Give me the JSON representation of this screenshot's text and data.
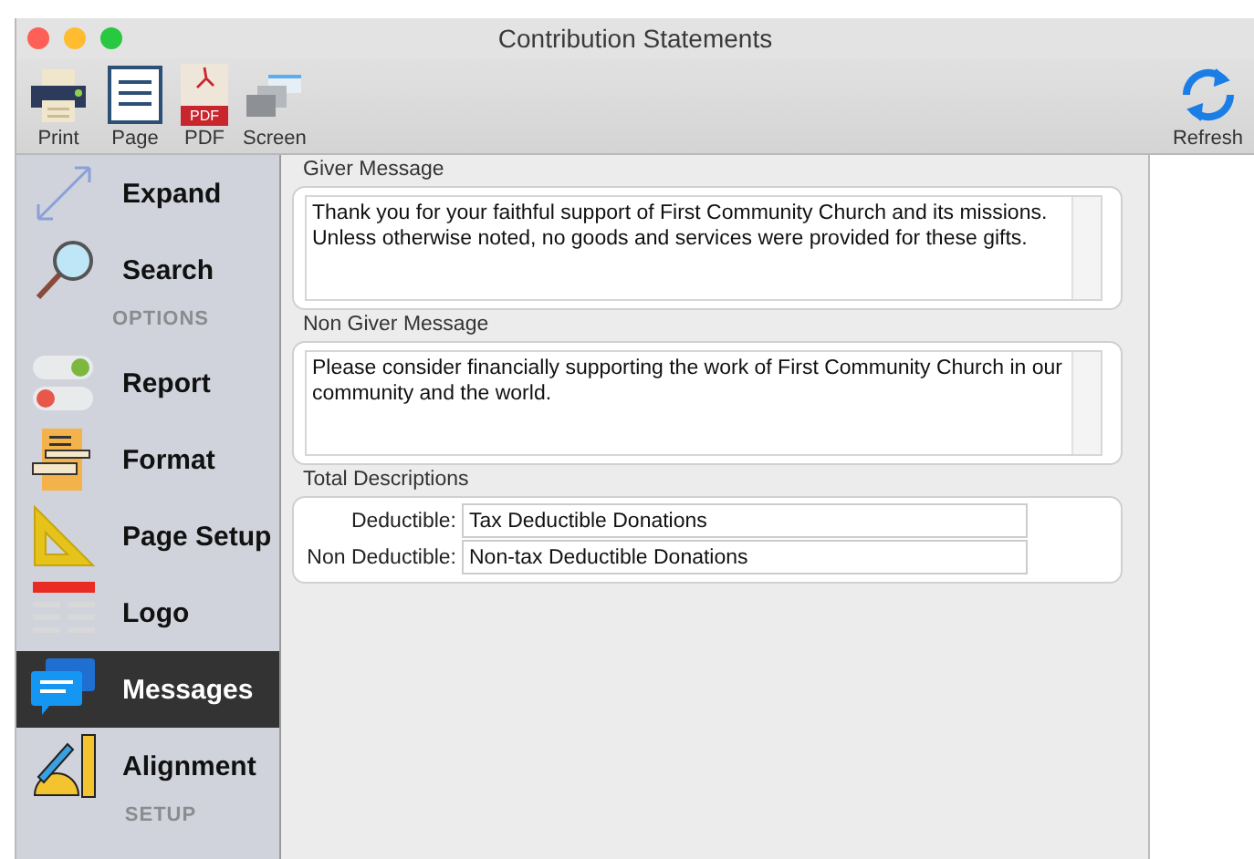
{
  "window": {
    "title": "Contribution Statements"
  },
  "toolbar": {
    "left": [
      {
        "label": "Print"
      },
      {
        "label": "Page"
      },
      {
        "label": "PDF",
        "icon_text": "PDF"
      },
      {
        "label": "Screen"
      }
    ],
    "right": [
      {
        "label": "Refresh"
      }
    ]
  },
  "sidebar": {
    "items": [
      {
        "kind": "item",
        "label": "Expand",
        "selected": false
      },
      {
        "kind": "item",
        "label": "Search",
        "selected": false
      },
      {
        "kind": "header",
        "label": "OPTIONS"
      },
      {
        "kind": "item",
        "label": "Report",
        "selected": false
      },
      {
        "kind": "item",
        "label": "Format",
        "selected": false
      },
      {
        "kind": "item",
        "label": "Page Setup",
        "selected": false
      },
      {
        "kind": "item",
        "label": "Logo",
        "selected": false
      },
      {
        "kind": "item",
        "label": "Messages",
        "selected": true
      },
      {
        "kind": "item",
        "label": "Alignment",
        "selected": false
      },
      {
        "kind": "header",
        "label": "SETUP"
      }
    ]
  },
  "giver_message": {
    "label": "Giver Message",
    "value": "Thank you for your faithful support of First Community Church and its missions. Unless otherwise noted, no goods and services were provided for these gifts."
  },
  "non_giver_message": {
    "label": "Non Giver Message",
    "value": "Please consider financially supporting the work of First Community Church in our community and the world."
  },
  "total_descriptions": {
    "label": "Total Descriptions",
    "fields": [
      {
        "label": "Deductible:",
        "value": "Tax Deductible Donations"
      },
      {
        "label": "Non Deductible:",
        "value": "Non-tax Deductible Donations"
      }
    ]
  }
}
